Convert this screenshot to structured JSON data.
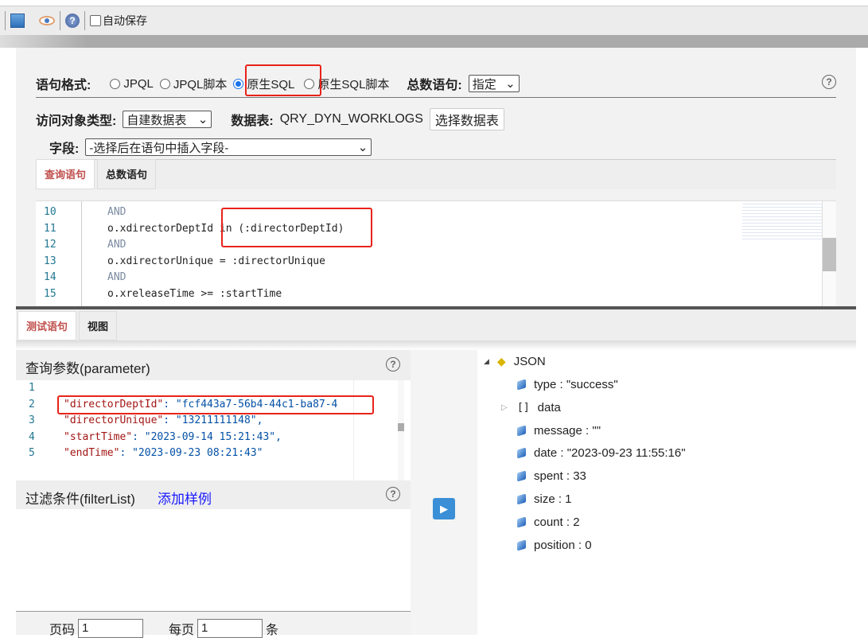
{
  "toolbar": {
    "autosave_label": "自动保存"
  },
  "form": {
    "format_label": "语句格式:",
    "formats": [
      "JPQL",
      "JPQL脚本",
      "原生SQL",
      "原生SQL脚本"
    ],
    "selected_format": "原生SQL",
    "count_label": "总数语句:",
    "count_value": "指定",
    "object_type_label": "访问对象类型:",
    "object_type_value": "自建数据表",
    "table_label": "数据表:",
    "table_value": "QRY_DYN_WORKLOGS",
    "select_table_button": "选择数据表",
    "field_label": "字段:",
    "field_placeholder": "-选择后在语句中插入字段-"
  },
  "editor_tabs": [
    "查询语句",
    "总数语句"
  ],
  "sql_lines": [
    {
      "n": "10",
      "text": "AND"
    },
    {
      "n": "11",
      "text": "o.xdirectorDeptId in (:directorDeptId)"
    },
    {
      "n": "12",
      "text": "AND"
    },
    {
      "n": "13",
      "text": "o.xdirectorUnique = :directorUnique"
    },
    {
      "n": "14",
      "text": "AND"
    },
    {
      "n": "15",
      "text": "o.xreleaseTime >= :startTime"
    }
  ],
  "bottom_tabs": [
    "测试语句",
    "视图"
  ],
  "params": {
    "title": "查询参数(parameter)",
    "lines": [
      {
        "n": "1",
        "key": "",
        "val": ""
      },
      {
        "n": "2",
        "key": "\"directorDeptId\"",
        "val": ": \"fcf443a7-56b4-44c1-ba87-4"
      },
      {
        "n": "3",
        "key": "\"directorUnique\"",
        "val": ": \"13211111148\","
      },
      {
        "n": "4",
        "key": "\"startTime\"",
        "val": ": \"2023-09-14 15:21:43\","
      },
      {
        "n": "5",
        "key": "\"endTime\"",
        "val": ": \"2023-09-23 08:21:43\""
      }
    ]
  },
  "filter": {
    "title": "过滤条件(filterList)",
    "add_sample": "添加样例"
  },
  "pagination": {
    "page_label": "页码",
    "page_value": "1",
    "per_page_label": "每页",
    "per_page_value": "1",
    "unit": "条"
  },
  "result": {
    "root": "JSON",
    "items": [
      {
        "text": "type : \"success\"",
        "kind": "value"
      },
      {
        "text": "data",
        "kind": "array"
      },
      {
        "text": "message : \"\"",
        "kind": "value"
      },
      {
        "text": "date : \"2023-09-23 11:55:16\"",
        "kind": "value"
      },
      {
        "text": "spent : 33",
        "kind": "value"
      },
      {
        "text": "size : 1",
        "kind": "value"
      },
      {
        "text": "count : 2",
        "kind": "value"
      },
      {
        "text": "position : 0",
        "kind": "value"
      }
    ]
  },
  "colors": {
    "highlight": "#e8231a",
    "active_tab": "#c0504d",
    "link": "#1a1aff",
    "run": "#3a8fd6"
  }
}
